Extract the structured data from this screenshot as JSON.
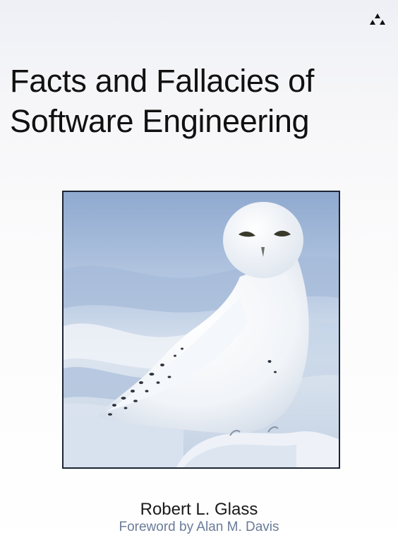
{
  "book": {
    "title_line_1": "Facts and Fallacies of",
    "title_line_2": "Software Engineering",
    "author": "Robert L. Glass",
    "foreword": "Foreword by Alan M. Davis"
  },
  "cover_image": {
    "subject": "snowy owl"
  },
  "publisher_logo": {
    "icon": "publisher-logo-icon"
  },
  "colors": {
    "title": "#111111",
    "author": "#1a1a1a",
    "foreword": "#6a7b99",
    "photo_border": "#1c2433",
    "sky": "#b9cbe4"
  }
}
